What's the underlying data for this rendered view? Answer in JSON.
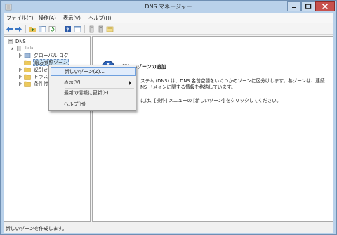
{
  "window": {
    "title": "DNS マネージャー"
  },
  "menubar": {
    "items": [
      "ファイル(F)",
      "操作(A)",
      "表示(V)",
      "ヘルプ(H)"
    ]
  },
  "toolbar": {
    "icons": [
      "back-arrow-icon",
      "forward-arrow-icon",
      "up-folder-icon",
      "show-hide-tree-icon",
      "refresh-icon",
      "help-icon",
      "properties-icon",
      "server-icon",
      "server-stopped-icon",
      "filter-icon"
    ]
  },
  "tree": {
    "root": "DNS",
    "server": "Ilala",
    "items": [
      {
        "label": "グローバル ログ"
      },
      {
        "label": "前方参照ゾーン"
      },
      {
        "label": "逆引き参照ゾーン"
      },
      {
        "label": "トラスト ポイント"
      },
      {
        "label": "条件付きフォワーダー"
      }
    ]
  },
  "detail": {
    "heading": "新しいゾーンの追加",
    "line1": "ステム (DNS) は、DNS 名前空間をいくつかのゾーンに区分けします。各ゾーンは、連続",
    "line2": "NS ドメインに関する情報を格納しています。",
    "line3": "には、[操作] メニューの [新しいゾーン] をクリックしてください。"
  },
  "context_menu": {
    "items": [
      {
        "label": "新しいゾーン(Z)...",
        "highlighted": true
      },
      {
        "label": "表示(V)",
        "submenu": true
      },
      {
        "label": "最新の情報に更新(F)"
      },
      {
        "label": "ヘルプ(H)"
      }
    ]
  },
  "statusbar": {
    "text": "新しいゾーンを作成します。"
  },
  "colors": {
    "titlebar": "#b9d1ea",
    "close_button": "#c7514d",
    "selection": "#cce4f7",
    "info_icon": "#2f64b8"
  }
}
